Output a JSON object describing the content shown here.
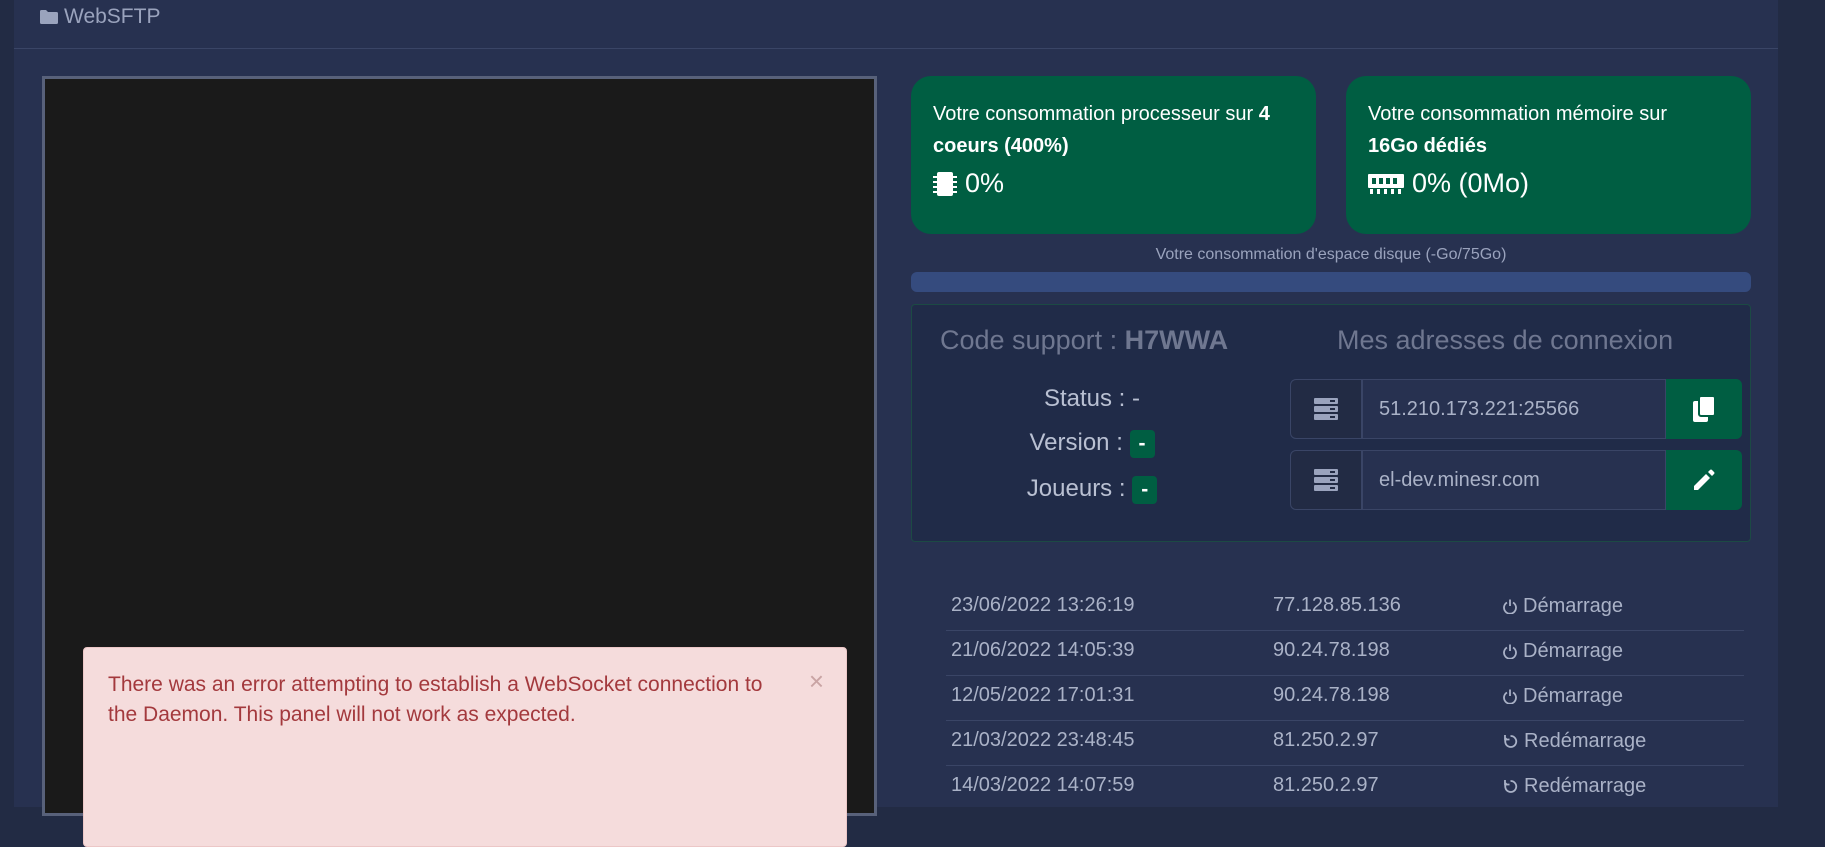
{
  "header": {
    "title": "WebSFTP",
    "icon": "folder-icon"
  },
  "cpu_card": {
    "text_prefix": "Votre consommation processeur sur ",
    "text_bold": "4 coeurs (400%)",
    "value": "0%",
    "icon": "cpu-chip-icon",
    "color": "#005e42"
  },
  "mem_card": {
    "text_prefix": "Votre consommation mémoire sur ",
    "text_bold": "16Go dédiés",
    "value": "0% (0Mo)",
    "icon": "memory-icon",
    "color": "#005e42"
  },
  "disk": {
    "label": "Votre consommation d'espace disque (-Go/75Go)",
    "progress_percent": 0
  },
  "support": {
    "label": "Code support : ",
    "code": "H7WWA"
  },
  "status": {
    "status_label": "Status : -",
    "version_label": "Version : ",
    "version_value": "-",
    "players_label": "Joueurs : ",
    "players_value": "-"
  },
  "addresses": {
    "title": "Mes adresses de connexion",
    "ip": "51.210.173.221:25566",
    "domain": "el-dev.minesr.com",
    "server_icon": "server-icon",
    "copy_icon": "copy-icon",
    "edit_icon": "pencil-icon"
  },
  "log": [
    {
      "date": "23/06/2022 13:26:19",
      "ip": "77.128.85.136",
      "action": "Démarrage",
      "icon": "power-icon"
    },
    {
      "date": "21/06/2022 14:05:39",
      "ip": "90.24.78.198",
      "action": "Démarrage",
      "icon": "power-icon"
    },
    {
      "date": "12/05/2022 17:01:31",
      "ip": "90.24.78.198",
      "action": "Démarrage",
      "icon": "power-icon"
    },
    {
      "date": "21/03/2022 23:48:45",
      "ip": "81.250.2.97",
      "action": "Redémarrage",
      "icon": "restart-icon"
    },
    {
      "date": "14/03/2022 14:07:59",
      "ip": "81.250.2.97",
      "action": "Redémarrage",
      "icon": "restart-icon"
    }
  ],
  "alert": {
    "message": "There was an error attempting to establish a WebSocket connection to the Daemon. This panel will not work as expected.",
    "close": "×"
  }
}
